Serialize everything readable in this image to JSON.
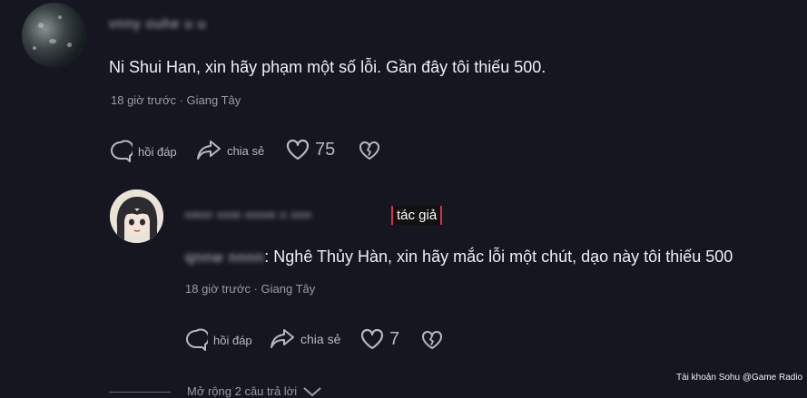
{
  "comment": {
    "username": "vnny ouhe u u",
    "text": "Ni Shui Han, xin hãy phạm một số lỗi. Gần đây tôi thiếu 500.",
    "meta": "18 giờ trước · Giang Tây",
    "reply_label": "hồi đáp",
    "share_label": "chia sẻ",
    "like_count": "75"
  },
  "reply": {
    "username": "nmnr nnm nnnm n nnn",
    "badge": "tác giả",
    "mention": "qnnw nnnn",
    "text": ": Nghê Thủy Hàn, xin hãy mắc lỗi một chút, dạo này tôi thiếu 500",
    "meta": "18 giờ trước · Giang Tây",
    "reply_label": "hồi đáp",
    "share_label": "chia sẻ",
    "like_count": "7"
  },
  "expand_label": "Mở rộng 2 câu trả lời",
  "watermark": "Tài khoản Sohu @Game Radio"
}
